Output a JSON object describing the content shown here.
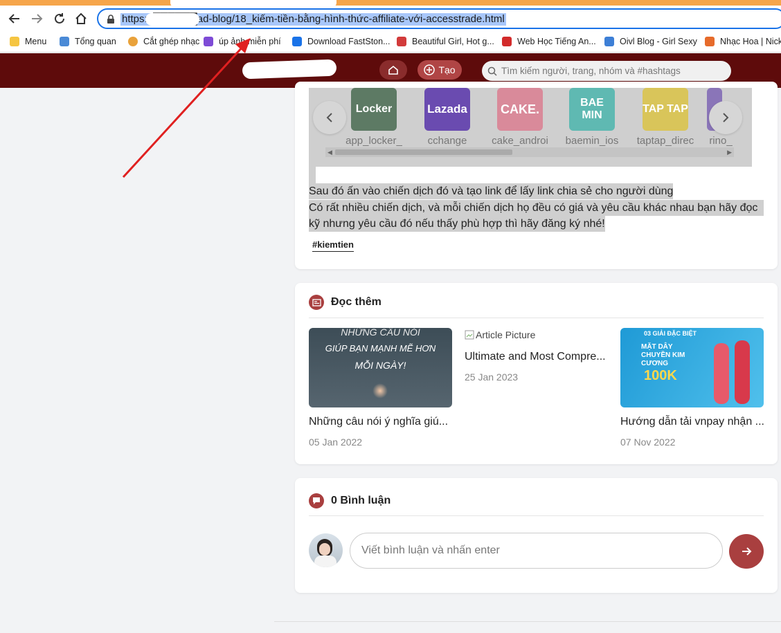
{
  "browser": {
    "url": "https://██████ad-blog/18_kiếm-tiền-bằng-hình-thức-affiliate-với-accesstrade.html",
    "bookmarks": [
      {
        "label": "Menu",
        "icon": "folder-icon",
        "color": "#f5c542"
      },
      {
        "label": "Tổng quan",
        "icon": "network-icon",
        "color": "#4a8ad6"
      },
      {
        "label": "Cắt ghép nhạc",
        "icon": "music-icon",
        "color": "#e9a23b"
      },
      {
        "label": "úp ảnh miễn phí",
        "icon": "feather-icon",
        "color": "#7e4bd6"
      },
      {
        "label": "Download FastSton...",
        "icon": "t-icon",
        "color": "#1a73e8"
      },
      {
        "label": "Beautiful Girl, Hot g...",
        "icon": "figure-icon",
        "color": "#d23b3b"
      },
      {
        "label": "Web Học Tiếng An...",
        "icon": "book-icon",
        "color": "#d22b2b"
      },
      {
        "label": "Oivl Blog - Girl Sexy",
        "icon": "blog-icon",
        "color": "#3d7fd6"
      },
      {
        "label": "Nhạc Hoa | Nicky",
        "icon": "heart-icon",
        "color": "#e66b2b"
      }
    ]
  },
  "header": {
    "create_label": "Tạo",
    "search_placeholder": "Tìm kiếm người, trang, nhóm và #hashtags"
  },
  "slider": {
    "items": [
      {
        "label": "app_locker_",
        "logo": "Locker",
        "color": "#5d7a64"
      },
      {
        "label": "cchange",
        "logo": "Lazada",
        "color": "#6a4bb0"
      },
      {
        "label": "cake_androi",
        "logo": "CAKE.",
        "color": "#d98a9a"
      },
      {
        "label": "baemin_ios",
        "logo": "BAE MIN",
        "color": "#5fb9b2"
      },
      {
        "label": "taptap_direc",
        "logo": "TAP TAP",
        "color": "#d9c55a"
      },
      {
        "label": "rino_",
        "logo": "",
        "color": "#8a75b8"
      }
    ]
  },
  "post": {
    "line1": "Sau đó ấn vào chiến dịch đó và tạo link để lấy link chia sẻ cho người dùng",
    "line2": "Có rất nhiều chiến dịch, và mỗi chiến dịch họ đều có giá và yêu cầu khác nhau bạn hãy đọc",
    "line3": "kỹ nhưng yêu cầu đó nếu thấy phù hợp thì hãy đăng ký nhé!",
    "hashtag": "#kiemtien"
  },
  "read_more": {
    "title": "Đọc thêm",
    "articles": [
      {
        "title": "Những câu nói ý nghĩa giú...",
        "date": "05 Jan 2022",
        "thumb_text_1": "NHỮNG CÂU NÓI",
        "thumb_text_2": "GIÚP BẠN MẠNH MẼ HƠN",
        "thumb_text_3": "MỖI NGÀY!"
      },
      {
        "title": "Ultimate and Most Compre...",
        "date": "25 Jan 2023",
        "alt": "Article Picture"
      },
      {
        "title": "Hướng dẫn tải vnpay nhận ...",
        "date": "07 Nov 2022",
        "thumb_text_1": "03 GIẢI ĐẶC BIỆT",
        "thumb_text_2": "MẶT DÂY CHUYỀN KIM CƯƠNG",
        "thumb_text_3": "100K"
      }
    ]
  },
  "comments": {
    "title": "0 Bình luận",
    "placeholder": "Viết bình luận và nhấn enter"
  }
}
